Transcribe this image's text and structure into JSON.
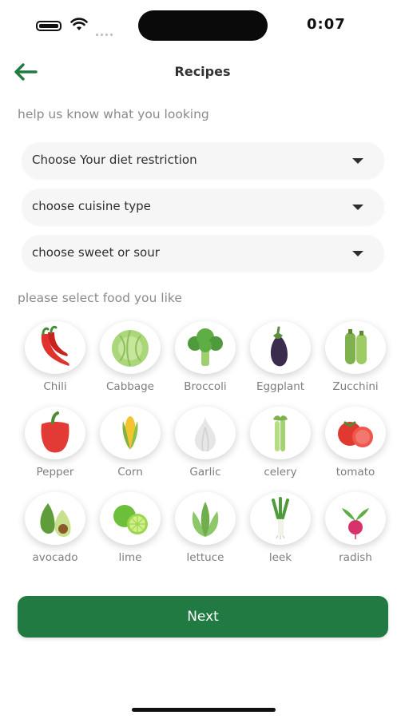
{
  "status_bar": {
    "time": "0:07"
  },
  "header": {
    "title": "Recipes"
  },
  "prompt_filters": "help us know what you looking",
  "selects": [
    {
      "value": "Choose Your diet restriction"
    },
    {
      "value": "choose cuisine type"
    },
    {
      "value": "choose sweet or sour"
    }
  ],
  "prompt_foods": "please select food you like",
  "foods": [
    {
      "label": "Chili"
    },
    {
      "label": "Cabbage"
    },
    {
      "label": "Broccoli"
    },
    {
      "label": "Eggplant"
    },
    {
      "label": "Zucchini"
    },
    {
      "label": "Pepper"
    },
    {
      "label": "Corn"
    },
    {
      "label": "Garlic"
    },
    {
      "label": "celery"
    },
    {
      "label": "tomato"
    },
    {
      "label": "avocado"
    },
    {
      "label": "lime"
    },
    {
      "label": "lettuce"
    },
    {
      "label": "leek"
    },
    {
      "label": "radish"
    }
  ],
  "next_button": {
    "label": "Next"
  },
  "colors": {
    "primary": "#217a41",
    "field_bg": "#f6f6f6",
    "muted_text": "#8a8a8a"
  }
}
